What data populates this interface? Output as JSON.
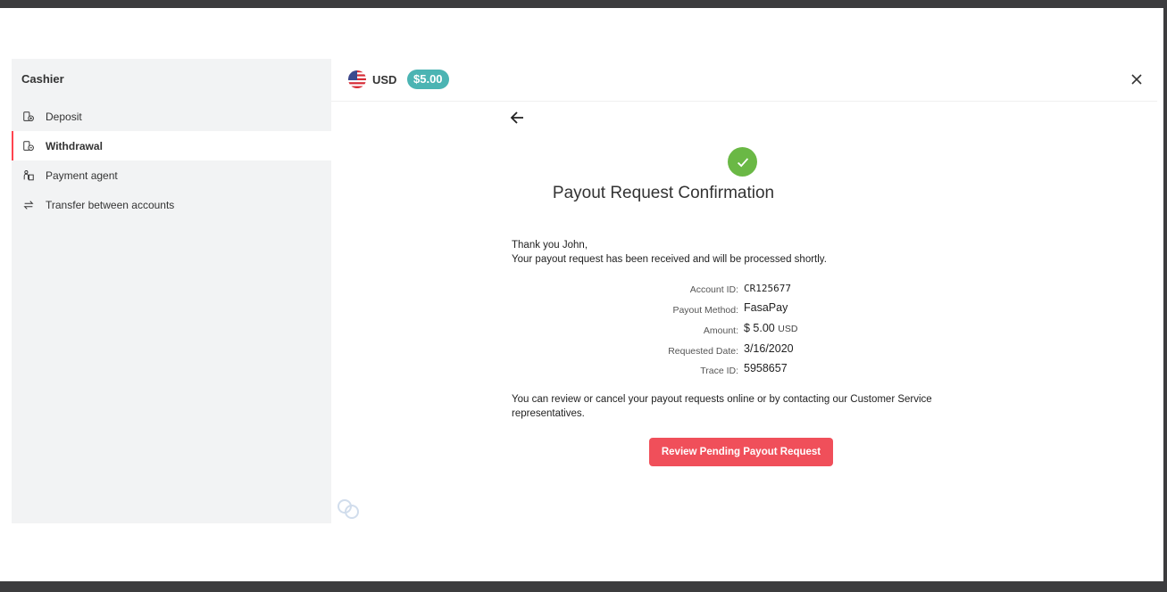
{
  "sidebar": {
    "title": "Cashier",
    "items": [
      {
        "label": "Deposit",
        "icon": "deposit-icon"
      },
      {
        "label": "Withdrawal",
        "icon": "withdrawal-icon",
        "active": true
      },
      {
        "label": "Payment agent",
        "icon": "payment-agent-icon"
      },
      {
        "label": "Transfer between accounts",
        "icon": "transfer-icon"
      }
    ]
  },
  "header": {
    "currency": "USD",
    "balance": "$5.00",
    "flag_icon": "us-flag-icon",
    "close_icon": "close-icon"
  },
  "confirmation": {
    "title": "Payout Request Confirmation",
    "greeting": "Thank you John,",
    "message": "Your payout request has been received and will be processed shortly.",
    "details": [
      {
        "label": "Account ID:",
        "value": "CR125677"
      },
      {
        "label": "Payout Method:",
        "value": "FasaPay"
      },
      {
        "label": "Amount:",
        "value": "$ 5.00",
        "unit": "USD"
      },
      {
        "label": "Requested Date:",
        "value": "3/16/2020"
      },
      {
        "label": "Trace ID:",
        "value": "5958657"
      }
    ],
    "note": "You can review or cancel your payout requests online or by contacting our Customer Service representatives.",
    "button_label": "Review Pending Payout Request"
  },
  "colors": {
    "accent": "#ff444f",
    "balance_badge": "#4bb4b3",
    "success": "#6ab845",
    "button": "#f04f5a"
  }
}
